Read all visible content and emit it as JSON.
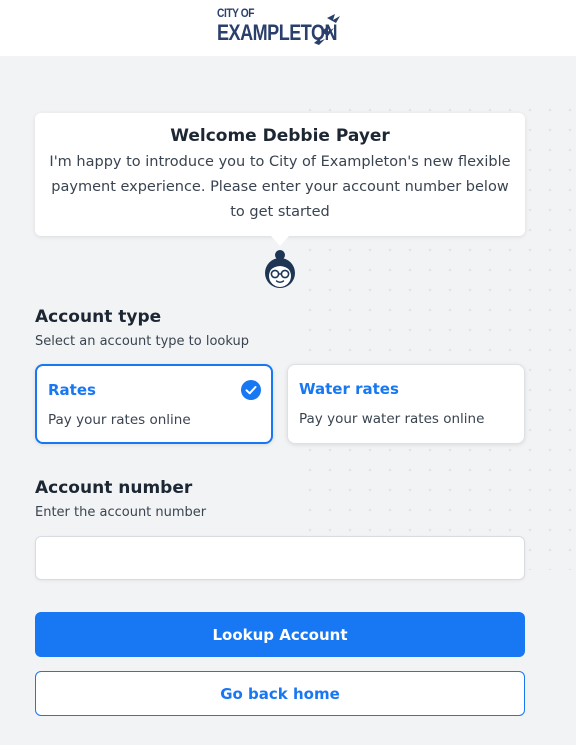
{
  "brand": {
    "logo_line1": "CITY OF",
    "logo_line2": "EXAMPLETON",
    "logo_icon": "birds-icon",
    "color": "#2a3f6b"
  },
  "welcome": {
    "title": "Welcome Debbie Payer",
    "message": "I'm happy to introduce you to City of Exampleton's new flexible payment experience. Please enter your account number below to get started",
    "avatar_icon": "assistant-avatar-icon"
  },
  "account_type": {
    "title": "Account type",
    "subtitle": "Select an account type to lookup",
    "options": [
      {
        "title": "Rates",
        "description": "Pay your rates online",
        "selected": true
      },
      {
        "title": "Water rates",
        "description": "Pay your water rates online",
        "selected": false
      }
    ]
  },
  "account_number": {
    "title": "Account number",
    "subtitle": "Enter the account number",
    "value": "",
    "placeholder": ""
  },
  "actions": {
    "lookup_label": "Lookup Account",
    "back_label": "Go back home"
  },
  "colors": {
    "accent": "#1877f2",
    "background": "#f2f3f5",
    "text": "#1c2733"
  }
}
